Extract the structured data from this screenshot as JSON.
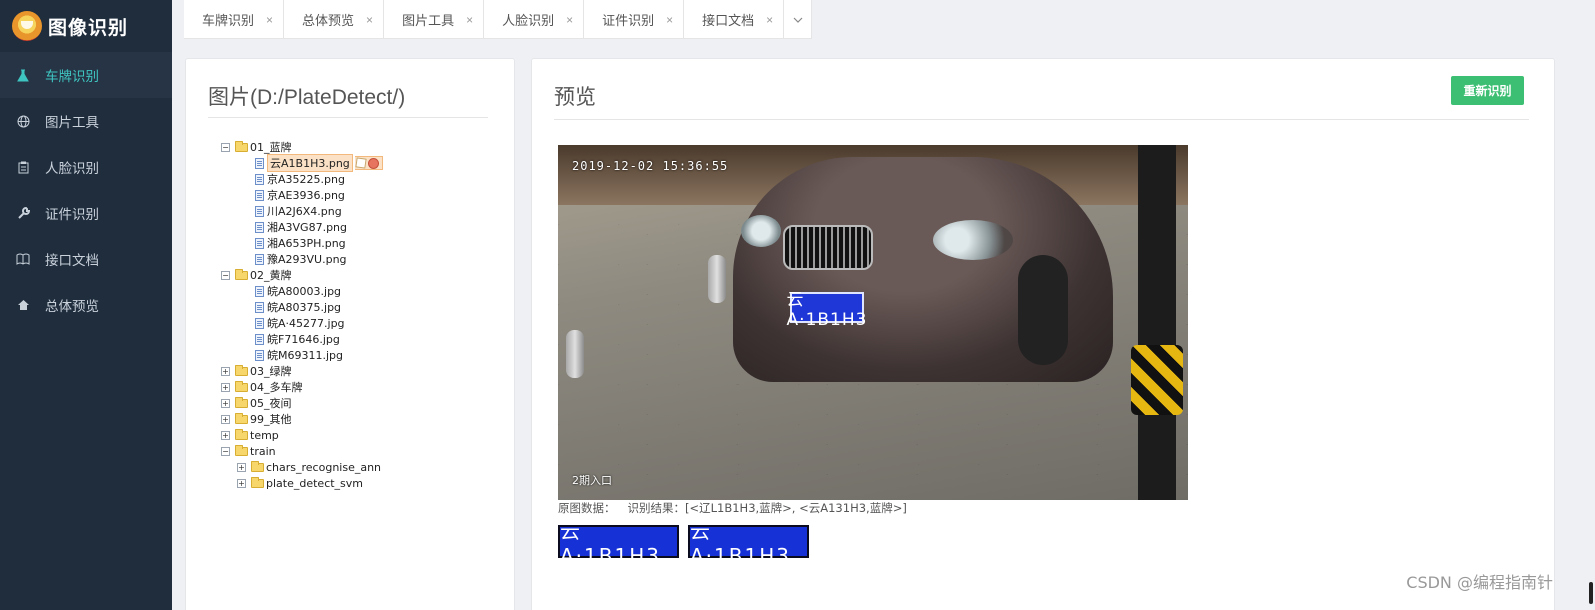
{
  "app": {
    "title": "图像识别"
  },
  "sidebar": {
    "items": [
      {
        "label": "车牌识别",
        "icon": "flask-icon",
        "active": true
      },
      {
        "label": "图片工具",
        "icon": "globe-icon"
      },
      {
        "label": "人脸识别",
        "icon": "clipboard-icon"
      },
      {
        "label": "证件识别",
        "icon": "wrench-icon"
      },
      {
        "label": "接口文档",
        "icon": "book-icon"
      },
      {
        "label": "总体预览",
        "icon": "home-icon"
      }
    ]
  },
  "tabs": [
    {
      "label": "车牌识别",
      "close": "×"
    },
    {
      "label": "总体预览",
      "close": "×"
    },
    {
      "label": "图片工具",
      "close": "×"
    },
    {
      "label": "人脸识别",
      "close": "×"
    },
    {
      "label": "证件识别",
      "close": "×"
    },
    {
      "label": "接口文档",
      "close": "×"
    }
  ],
  "left_panel": {
    "title": "图片(D:/PlateDetect/)",
    "tree": [
      {
        "label": "01_蓝牌",
        "type": "folder",
        "expanded": true,
        "toggle": "−",
        "children": [
          {
            "label": "云A1B1H3.png",
            "selected": true
          },
          {
            "label": "京A35225.png"
          },
          {
            "label": "京AE3936.png"
          },
          {
            "label": "川A2J6X4.png"
          },
          {
            "label": "湘A3VG87.png"
          },
          {
            "label": "湘A653PH.png"
          },
          {
            "label": "豫A293VU.png"
          }
        ]
      },
      {
        "label": "02_黄牌",
        "type": "folder",
        "expanded": true,
        "toggle": "−",
        "children": [
          {
            "label": "皖A80003.jpg"
          },
          {
            "label": "皖A80375.jpg"
          },
          {
            "label": "皖A·45277.jpg"
          },
          {
            "label": "皖F71646.jpg"
          },
          {
            "label": "皖M69311.jpg"
          }
        ]
      },
      {
        "label": "03_绿牌",
        "type": "folder",
        "toggle": "+"
      },
      {
        "label": "04_多车牌",
        "type": "folder",
        "toggle": "+"
      },
      {
        "label": "05_夜间",
        "type": "folder",
        "toggle": "+"
      },
      {
        "label": "99_其他",
        "type": "folder",
        "toggle": "+"
      },
      {
        "label": "temp",
        "type": "folder",
        "toggle": "+"
      },
      {
        "label": "train",
        "type": "folder",
        "expanded": true,
        "toggle": "−",
        "children": [
          {
            "label": "chars_recognise_ann",
            "type": "folder",
            "toggle": "+"
          },
          {
            "label": "plate_detect_svm",
            "type": "folder",
            "toggle": "+"
          }
        ]
      }
    ]
  },
  "right_panel": {
    "title": "预览",
    "button_label": "重新识别",
    "photo": {
      "timestamp": "2019-12-02 15:36:55",
      "caption": "2期入口",
      "plate_text": "云A·1B1H3"
    },
    "result": {
      "original_label": "原图数据：",
      "result_text": "识别结果：[<辽L1B1H3,蓝牌>, <云A131H3,蓝牌>]"
    },
    "plate_crops": [
      "云A·1B1H3",
      "云A·1B1H3"
    ]
  },
  "watermark": "CSDN @编程指南针",
  "colors": {
    "sidebar_bg": "#1f2d3d",
    "active_text": "#3fc5c1",
    "button_bg": "#3cbf73"
  }
}
